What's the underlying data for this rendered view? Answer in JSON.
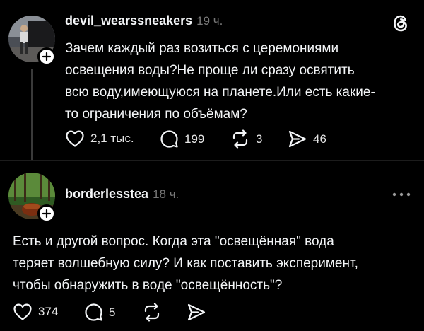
{
  "colors": {
    "background": "#000000",
    "text_primary": "#f3f5f7",
    "text_secondary": "#777777",
    "thread_line": "#3a3a3a"
  },
  "posts": [
    {
      "username": "devil_wearssneakers",
      "time": "19 ч.",
      "text_lines": [
        "Зачем каждый раз возиться с церемониями",
        "освещения воды?Не проще ли сразу освятить",
        "всю воду,имеющуюся на планете.Или есть какие-",
        "то ограничения по объёмам?"
      ],
      "likes": "2,1 тыс.",
      "comments": "199",
      "reposts": "3",
      "shares": "46"
    },
    {
      "username": "borderlesstea",
      "time": "18 ч.",
      "text_lines": [
        "Есть и другой вопрос. Когда эта \"освещённая\" вода",
        "теряет волшебную силу? И как поставить эксперимент,",
        "чтобы обнаружить в воде \"освещённость\"?"
      ],
      "likes": "374",
      "comments": "5"
    }
  ],
  "icons": {
    "app_logo": "threads-logo-icon",
    "like": "heart-icon",
    "comment": "comment-icon",
    "repost": "repost-icon",
    "share": "send-icon",
    "more": "more-options-icon",
    "follow": "plus-icon"
  }
}
